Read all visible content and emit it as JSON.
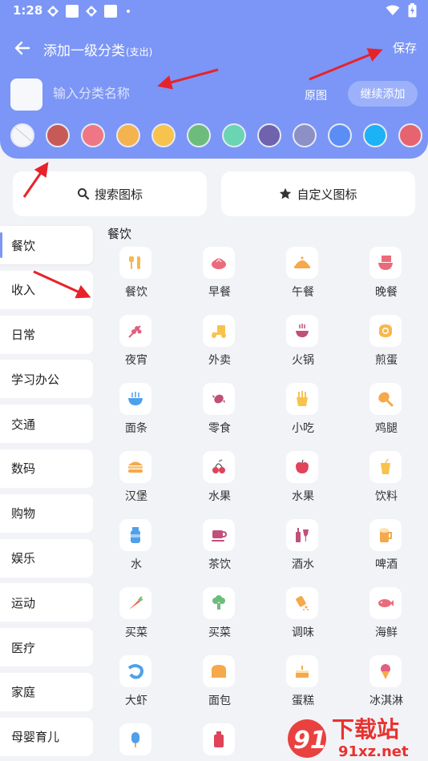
{
  "status_bar": {
    "time": "1:28"
  },
  "header": {
    "title": "添加一级分类",
    "title_suffix": "(支出)",
    "save_label": "保存",
    "name_placeholder": "输入分类名称",
    "original_label": "原图",
    "continue_label": "继续添加",
    "colors": [
      "none",
      "#c75a57",
      "#ef7785",
      "#f5b34f",
      "#f8c34d",
      "#6cbd7c",
      "#6ad5b3",
      "#6f63ad",
      "#8d8fc7",
      "#5b8ef5",
      "#1cb2f5",
      "#e56470"
    ]
  },
  "search_label": "搜索图标",
  "custom_icon_label": "自定义图标",
  "sidebar": {
    "items": [
      "餐饮",
      "收入",
      "日常",
      "学习办公",
      "交通",
      "数码",
      "购物",
      "娱乐",
      "运动",
      "医疗",
      "家庭",
      "母婴育儿"
    ],
    "active": "餐饮"
  },
  "section_title": "餐饮",
  "icons": [
    {
      "label": "餐饮",
      "icon": "fork-knife-icon",
      "color": "#f7b84c"
    },
    {
      "label": "早餐",
      "icon": "bun-icon",
      "color": "#ea6b7a"
    },
    {
      "label": "午餐",
      "icon": "cloche-icon",
      "color": "#f5a94a"
    },
    {
      "label": "晚餐",
      "icon": "noodle-bowl-icon",
      "color": "#ea6b7a"
    },
    {
      "label": "夜宵",
      "icon": "skewers-icon",
      "color": "#e0607e"
    },
    {
      "label": "外卖",
      "icon": "scooter-icon",
      "color": "#f8c34d"
    },
    {
      "label": "火锅",
      "icon": "hotpot-icon",
      "color": "#c0507a"
    },
    {
      "label": "煎蛋",
      "icon": "fried-egg-icon",
      "color": "#f7b84c"
    },
    {
      "label": "面条",
      "icon": "noodles-icon",
      "color": "#4ea0ea"
    },
    {
      "label": "零食",
      "icon": "candy-icon",
      "color": "#c0507a"
    },
    {
      "label": "小吃",
      "icon": "fries-icon",
      "color": "#f8c34d"
    },
    {
      "label": "鸡腿",
      "icon": "drumstick-icon",
      "color": "#f5a94a"
    },
    {
      "label": "汉堡",
      "icon": "burger-icon",
      "color": "#f5a94a"
    },
    {
      "label": "水果",
      "icon": "cherry-icon",
      "color": "#e0435a"
    },
    {
      "label": "水果",
      "icon": "apple-icon",
      "color": "#e0435a"
    },
    {
      "label": "饮料",
      "icon": "drink-cup-icon",
      "color": "#f8c34d"
    },
    {
      "label": "水",
      "icon": "water-bottle-icon",
      "color": "#4ea0ea"
    },
    {
      "label": "茶饮",
      "icon": "tea-cup-icon",
      "color": "#c0507a"
    },
    {
      "label": "酒水",
      "icon": "wine-icon",
      "color": "#c0507a"
    },
    {
      "label": "啤酒",
      "icon": "beer-icon",
      "color": "#f5a94a"
    },
    {
      "label": "买菜",
      "icon": "carrot-icon",
      "color": "#ea6b4a"
    },
    {
      "label": "买菜",
      "icon": "broccoli-icon",
      "color": "#6cbd7c"
    },
    {
      "label": "调味",
      "icon": "seasoning-icon",
      "color": "#f5a94a"
    },
    {
      "label": "海鲜",
      "icon": "fish-icon",
      "color": "#ea6b7a"
    },
    {
      "label": "大虾",
      "icon": "shrimp-icon",
      "color": "#4ea0ea"
    },
    {
      "label": "面包",
      "icon": "bread-icon",
      "color": "#f5a94a"
    },
    {
      "label": "蛋糕",
      "icon": "cake-icon",
      "color": "#f5a94a"
    },
    {
      "label": "冰淇淋",
      "icon": "ice-cream-icon",
      "color": "#e0607e"
    },
    {
      "label": "",
      "icon": "popsicle-icon",
      "color": "#4ea0ea"
    },
    {
      "label": "",
      "icon": "bottle-icon",
      "color": "#e0435a"
    }
  ],
  "watermark": {
    "brand": "下载站",
    "domain": "91xz.net",
    "logo_text": "91"
  }
}
